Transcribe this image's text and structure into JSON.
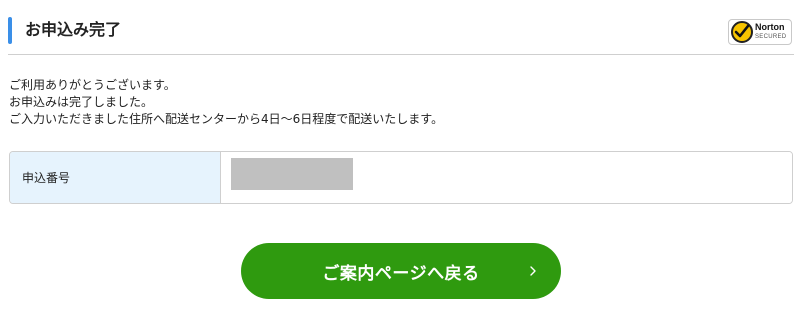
{
  "header": {
    "title": "お申込み完了",
    "badge": {
      "name": "Norton",
      "sub": "SECURED",
      "icon": "check-icon"
    }
  },
  "message": {
    "lines": [
      "ご利用ありがとうございます。",
      "お申込みは完了しました。",
      "ご入力いただきました住所へ配送センターから4日〜6日程度で配送いたします。"
    ]
  },
  "order": {
    "label": "申込番号",
    "value": ""
  },
  "back_button": {
    "label": "ご案内ページへ戻る",
    "icon": "chevron-right-icon"
  },
  "colors": {
    "accent": "#3a8fe8",
    "button": "#2f9a0f",
    "label_bg": "#e6f3fd",
    "mask": "#c0c0c0",
    "norton_yellow": "#f7c400"
  }
}
